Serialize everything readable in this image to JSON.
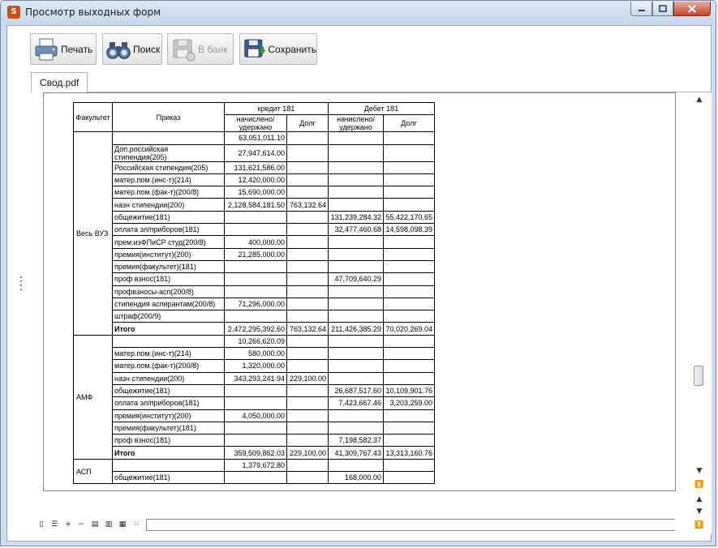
{
  "window": {
    "title": "Просмотр выходных форм",
    "app_icon_text": "S"
  },
  "toolbar": {
    "print_label": "Печать",
    "search_label": "Поиск",
    "bank_label": "В банк",
    "save_label": "Сохранить"
  },
  "tabs": [
    {
      "label": "Свод.pdf"
    }
  ],
  "report": {
    "header": {
      "faculty": "Факультет",
      "order": "Приказ",
      "credit": "кредит 181",
      "debit": "Дебет 181",
      "accrued": "начислено/ удержано",
      "debt": "Долг"
    },
    "groups": [
      {
        "name": "Весь ВУЗ",
        "rows": [
          [
            "",
            "63,051,011.10",
            "",
            "",
            ""
          ],
          [
            "Доп.российская стипендия(205)",
            "27,947,614.00",
            "",
            "",
            ""
          ],
          [
            "Российская стипендия(205)",
            "131,621,586.00",
            "",
            "",
            ""
          ],
          [
            "матер.пом.(инс-т)(214)",
            "12,420,000.00",
            "",
            "",
            ""
          ],
          [
            "матер.пом.(фак-т)(200/8)",
            "15,690,000.00",
            "",
            "",
            ""
          ],
          [
            "назн стипендии(200)",
            "2,128,584,181.50",
            "763,132.64",
            "",
            ""
          ],
          [
            "общежитие(181)",
            "",
            "",
            "131,239,284.32",
            "55,422,170.65"
          ],
          [
            "оплата эл/приборов(181)",
            "",
            "",
            "32,477,460.68",
            "14,598,098.39"
          ],
          [
            "прем.изФПиСР студ(200/8)",
            "400,000.00",
            "",
            "",
            ""
          ],
          [
            "премия(институт)(200)",
            "21,285,000.00",
            "",
            "",
            ""
          ],
          [
            "премия(факультет)(181)",
            "",
            "",
            "",
            ""
          ],
          [
            "проф взнос(181)",
            "",
            "",
            "47,709,640.29",
            ""
          ],
          [
            "профвзносы-асп(200/8)",
            "",
            "",
            "",
            ""
          ],
          [
            "стипендия аспирантам(200/8)",
            "71,296,000.00",
            "",
            "",
            ""
          ],
          [
            "штраф(200/9)",
            "",
            "",
            "",
            ""
          ],
          [
            "Итого",
            "2,472,295,392.60",
            "763,132.64",
            "211,426,385.29",
            "70,020,269.04"
          ]
        ]
      },
      {
        "name": "АМФ",
        "rows": [
          [
            "",
            "10,266,620.09",
            "",
            "",
            ""
          ],
          [
            "матер.пом.(инс-т)(214)",
            "580,000.00",
            "",
            "",
            ""
          ],
          [
            "матер.пом.(фак-т)(200/8)",
            "1,320,000.00",
            "",
            "",
            ""
          ],
          [
            "назн стипендии(200)",
            "343,293,241.94",
            "229,100.00",
            "",
            ""
          ],
          [
            "общежитие(181)",
            "",
            "",
            "26,687,517.60",
            "10,109,901.76"
          ],
          [
            "оплата эл/приборов(181)",
            "",
            "",
            "7,423,667.46",
            "3,203,259.00"
          ],
          [
            "премия(институт)(200)",
            "4,050,000.00",
            "",
            "",
            ""
          ],
          [
            "премия(факультет)(181)",
            "",
            "",
            "",
            ""
          ],
          [
            "проф взнос(181)",
            "",
            "",
            "7,198,582.37",
            ""
          ],
          [
            "Итого",
            "359,509,862.03",
            "229,100.00",
            "41,309,767.43",
            "13,313,160.76"
          ]
        ]
      },
      {
        "name": "АСП",
        "rows": [
          [
            "",
            "1,379,672.80",
            "",
            "",
            ""
          ],
          [
            "общежитие(181)",
            "",
            "",
            "168,000.00",
            ""
          ]
        ]
      }
    ]
  }
}
